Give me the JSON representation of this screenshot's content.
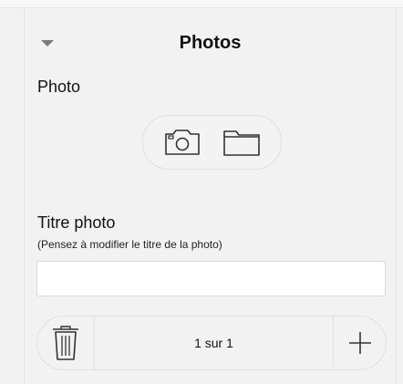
{
  "section": {
    "title": "Photos",
    "collapse_icon": "chevron-down-icon"
  },
  "photo": {
    "label": "Photo",
    "actions": {
      "camera_icon": "camera-icon",
      "folder_icon": "folder-icon"
    }
  },
  "titre": {
    "label": "Titre photo",
    "hint": "(Pensez à modifier le titre de la photo)",
    "value": "",
    "placeholder": ""
  },
  "pager": {
    "text": "1 sur 1",
    "delete_icon": "trash-icon",
    "add_icon": "plus-icon"
  }
}
